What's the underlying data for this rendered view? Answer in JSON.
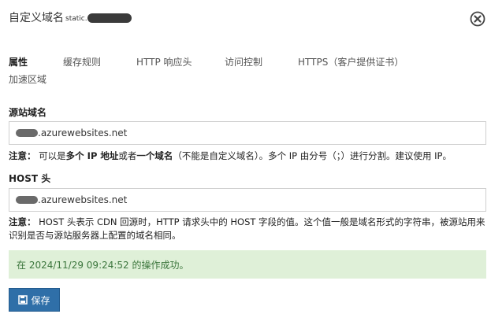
{
  "dialog": {
    "title": "自定义域名",
    "title_suffix": "static.",
    "close_label": "close"
  },
  "tabs": [
    {
      "label": "属性"
    },
    {
      "label": "缓存规则"
    },
    {
      "label": "HTTP 响应头"
    },
    {
      "label": "访问控制"
    },
    {
      "label": "HTTPS（客户提供证书）"
    },
    {
      "label": "加速区域"
    }
  ],
  "origin": {
    "label": "源站域名",
    "value": ".azurewebsites.net",
    "note_prefix": "注意：",
    "note_text1": " 可以是",
    "note_bold1": "多个 IP 地址",
    "note_text2": "或者",
    "note_bold2": "一个域名",
    "note_text3": "（不能是自定义域名）。多个 IP 由分号（；）进行分割。建议使用 IP。"
  },
  "host": {
    "label": "HOST 头",
    "value": ".azurewebsites.net",
    "note_prefix": "注意：",
    "note_text": " HOST 头表示 CDN 回源时，HTTP 请求头中的 HOST 字段的值。这个值一般是域名形式的字符串，被源站用来识别是否与源站服务器上配置的域名相同。"
  },
  "status": {
    "message": "在 2024/11/29 09:24:52 的操作成功。"
  },
  "actions": {
    "save_label": "保存"
  },
  "colors": {
    "success_bg": "#dff0d8",
    "success_text": "#3c763d",
    "primary": "#2f6fa8"
  }
}
